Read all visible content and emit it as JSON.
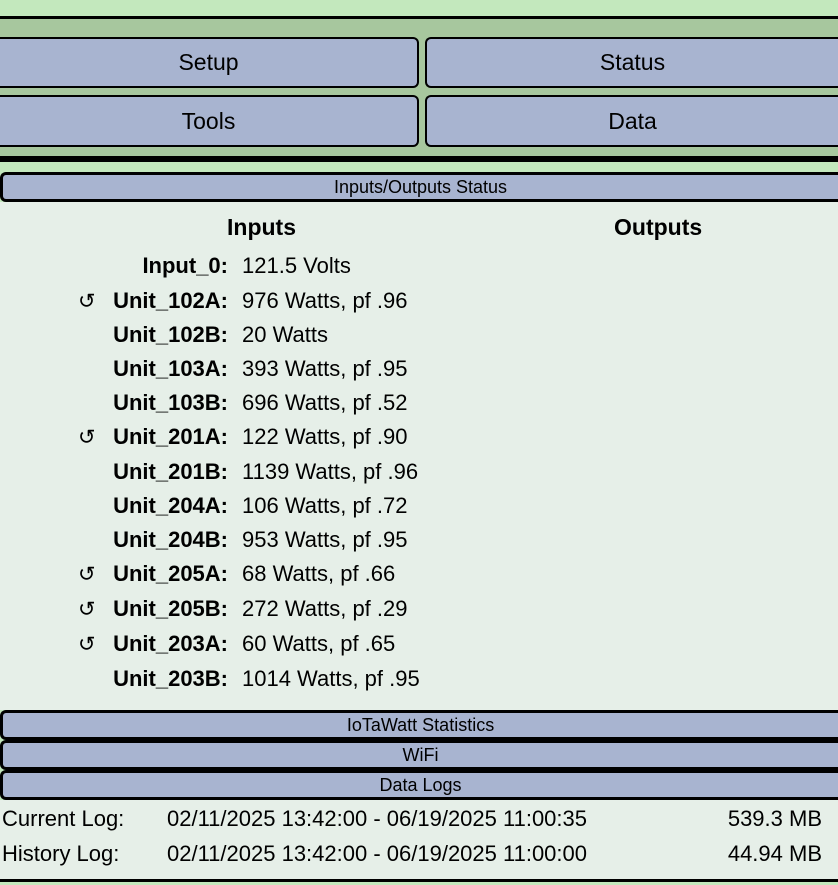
{
  "menu": {
    "setup": "Setup",
    "status": "Status",
    "tools": "Tools",
    "data": "Data"
  },
  "io_status": {
    "title": "Inputs/Outputs Status",
    "inputs_heading": "Inputs",
    "outputs_heading": "Outputs",
    "inputs": [
      {
        "label": "Input_0:",
        "value": "121.5 Volts",
        "refresh": false
      },
      {
        "label": "Unit_102A:",
        "value": "976 Watts, pf .96",
        "refresh": true
      },
      {
        "label": "Unit_102B:",
        "value": "20 Watts",
        "refresh": false
      },
      {
        "label": "Unit_103A:",
        "value": "393 Watts, pf .95",
        "refresh": false
      },
      {
        "label": "Unit_103B:",
        "value": "696 Watts, pf .52",
        "refresh": false
      },
      {
        "label": "Unit_201A:",
        "value": "122 Watts, pf .90",
        "refresh": true
      },
      {
        "label": "Unit_201B:",
        "value": "1139 Watts, pf .96",
        "refresh": false
      },
      {
        "label": "Unit_204A:",
        "value": "106 Watts, pf .72",
        "refresh": false
      },
      {
        "label": "Unit_204B:",
        "value": "953 Watts, pf .95",
        "refresh": false
      },
      {
        "label": "Unit_205A:",
        "value": "68 Watts, pf .66",
        "refresh": true
      },
      {
        "label": "Unit_205B:",
        "value": "272 Watts, pf .29",
        "refresh": true
      },
      {
        "label": "Unit_203A:",
        "value": "60 Watts, pf .65",
        "refresh": true
      },
      {
        "label": "Unit_203B:",
        "value": "1014 Watts, pf .95",
        "refresh": false
      }
    ],
    "refresh_glyph": "↺"
  },
  "sections": {
    "stats": "IoTaWatt Statistics",
    "wifi": "WiFi",
    "datalogs": "Data Logs"
  },
  "logs": [
    {
      "name": "Current Log:",
      "range": "02/11/2025 13:42:00 - 06/19/2025 11:00:35",
      "size": "539.3 MB"
    },
    {
      "name": "History Log:",
      "range": "02/11/2025 13:42:00 - 06/19/2025 11:00:00",
      "size": "44.94 MB"
    }
  ]
}
